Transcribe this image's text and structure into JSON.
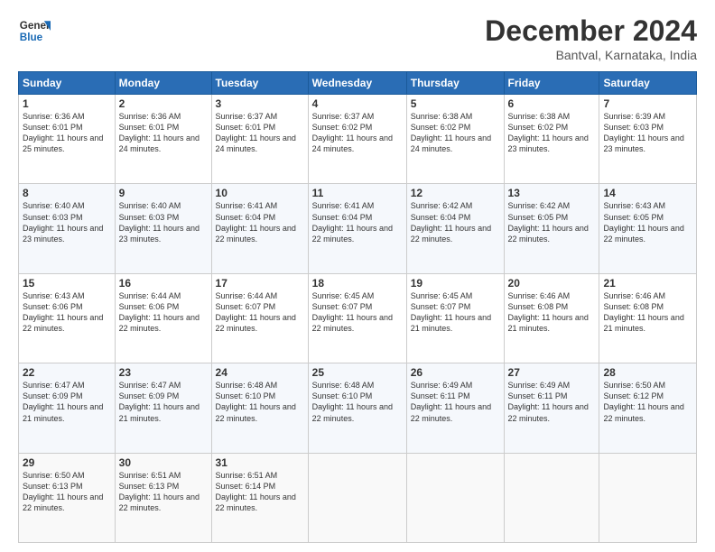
{
  "logo": {
    "line1": "General",
    "line2": "Blue"
  },
  "title": "December 2024",
  "location": "Bantval, Karnataka, India",
  "days_of_week": [
    "Sunday",
    "Monday",
    "Tuesday",
    "Wednesday",
    "Thursday",
    "Friday",
    "Saturday"
  ],
  "weeks": [
    [
      {
        "day": "1",
        "rise": "6:36 AM",
        "set": "6:01 PM",
        "daylight": "11 hours and 25 minutes."
      },
      {
        "day": "2",
        "rise": "6:36 AM",
        "set": "6:01 PM",
        "daylight": "11 hours and 24 minutes."
      },
      {
        "day": "3",
        "rise": "6:37 AM",
        "set": "6:01 PM",
        "daylight": "11 hours and 24 minutes."
      },
      {
        "day": "4",
        "rise": "6:37 AM",
        "set": "6:02 PM",
        "daylight": "11 hours and 24 minutes."
      },
      {
        "day": "5",
        "rise": "6:38 AM",
        "set": "6:02 PM",
        "daylight": "11 hours and 24 minutes."
      },
      {
        "day": "6",
        "rise": "6:38 AM",
        "set": "6:02 PM",
        "daylight": "11 hours and 23 minutes."
      },
      {
        "day": "7",
        "rise": "6:39 AM",
        "set": "6:03 PM",
        "daylight": "11 hours and 23 minutes."
      }
    ],
    [
      {
        "day": "8",
        "rise": "6:40 AM",
        "set": "6:03 PM",
        "daylight": "11 hours and 23 minutes."
      },
      {
        "day": "9",
        "rise": "6:40 AM",
        "set": "6:03 PM",
        "daylight": "11 hours and 23 minutes."
      },
      {
        "day": "10",
        "rise": "6:41 AM",
        "set": "6:04 PM",
        "daylight": "11 hours and 22 minutes."
      },
      {
        "day": "11",
        "rise": "6:41 AM",
        "set": "6:04 PM",
        "daylight": "11 hours and 22 minutes."
      },
      {
        "day": "12",
        "rise": "6:42 AM",
        "set": "6:04 PM",
        "daylight": "11 hours and 22 minutes."
      },
      {
        "day": "13",
        "rise": "6:42 AM",
        "set": "6:05 PM",
        "daylight": "11 hours and 22 minutes."
      },
      {
        "day": "14",
        "rise": "6:43 AM",
        "set": "6:05 PM",
        "daylight": "11 hours and 22 minutes."
      }
    ],
    [
      {
        "day": "15",
        "rise": "6:43 AM",
        "set": "6:06 PM",
        "daylight": "11 hours and 22 minutes."
      },
      {
        "day": "16",
        "rise": "6:44 AM",
        "set": "6:06 PM",
        "daylight": "11 hours and 22 minutes."
      },
      {
        "day": "17",
        "rise": "6:44 AM",
        "set": "6:07 PM",
        "daylight": "11 hours and 22 minutes."
      },
      {
        "day": "18",
        "rise": "6:45 AM",
        "set": "6:07 PM",
        "daylight": "11 hours and 22 minutes."
      },
      {
        "day": "19",
        "rise": "6:45 AM",
        "set": "6:07 PM",
        "daylight": "11 hours and 21 minutes."
      },
      {
        "day": "20",
        "rise": "6:46 AM",
        "set": "6:08 PM",
        "daylight": "11 hours and 21 minutes."
      },
      {
        "day": "21",
        "rise": "6:46 AM",
        "set": "6:08 PM",
        "daylight": "11 hours and 21 minutes."
      }
    ],
    [
      {
        "day": "22",
        "rise": "6:47 AM",
        "set": "6:09 PM",
        "daylight": "11 hours and 21 minutes."
      },
      {
        "day": "23",
        "rise": "6:47 AM",
        "set": "6:09 PM",
        "daylight": "11 hours and 21 minutes."
      },
      {
        "day": "24",
        "rise": "6:48 AM",
        "set": "6:10 PM",
        "daylight": "11 hours and 22 minutes."
      },
      {
        "day": "25",
        "rise": "6:48 AM",
        "set": "6:10 PM",
        "daylight": "11 hours and 22 minutes."
      },
      {
        "day": "26",
        "rise": "6:49 AM",
        "set": "6:11 PM",
        "daylight": "11 hours and 22 minutes."
      },
      {
        "day": "27",
        "rise": "6:49 AM",
        "set": "6:11 PM",
        "daylight": "11 hours and 22 minutes."
      },
      {
        "day": "28",
        "rise": "6:50 AM",
        "set": "6:12 PM",
        "daylight": "11 hours and 22 minutes."
      }
    ],
    [
      {
        "day": "29",
        "rise": "6:50 AM",
        "set": "6:13 PM",
        "daylight": "11 hours and 22 minutes."
      },
      {
        "day": "30",
        "rise": "6:51 AM",
        "set": "6:13 PM",
        "daylight": "11 hours and 22 minutes."
      },
      {
        "day": "31",
        "rise": "6:51 AM",
        "set": "6:14 PM",
        "daylight": "11 hours and 22 minutes."
      },
      null,
      null,
      null,
      null
    ]
  ]
}
